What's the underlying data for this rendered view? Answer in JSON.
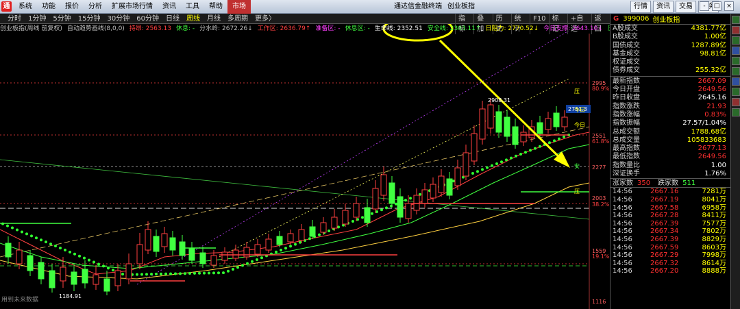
{
  "titlebar": {
    "menu": [
      "系统",
      "功能",
      "报价",
      "分析",
      "扩展市场行情",
      "资讯",
      "工具",
      "帮助",
      "市场"
    ],
    "title": "通达信金融终端",
    "subtitle": "创业板指",
    "buttons": [
      "行情",
      "资讯",
      "交易",
      "服务"
    ],
    "window_controls": [
      "-",
      "□",
      "×"
    ]
  },
  "toolbar": {
    "periods": [
      "分时",
      "1分钟",
      "5分钟",
      "15分钟",
      "30分钟",
      "60分钟",
      "日线",
      "周线",
      "月线",
      "多周期",
      "更多〉"
    ],
    "active_period": "周线",
    "tools": [
      "指标",
      "叠加",
      "历史",
      "统计",
      "F10",
      "标记",
      "+自选",
      "返回"
    ]
  },
  "legend": {
    "items": [
      {
        "text": "创业板指(周线 前复权)",
        "color": "#c0c0c0"
      },
      {
        "text": "自动趋势画线(8,0,0)",
        "color": "#c0c0c0"
      },
      {
        "text": "持昂: 2563.13",
        "color": "#ff4040"
      },
      {
        "text": "休息: -",
        "color": "#40ff40"
      },
      {
        "text": "分水岭: 2672.26↓",
        "color": "#c0c0c0"
      },
      {
        "text": "工作区: 2636.79↑",
        "color": "#ff4040"
      },
      {
        "text": "准备区: -",
        "color": "#ff40ff"
      },
      {
        "text": "休息区: -",
        "color": "#40ff40"
      },
      {
        "text": "生命线: 2352.51",
        "color": "#ffffff"
      },
      {
        "text": "安全线: 2303.11↑",
        "color": "#40ff40"
      },
      {
        "text": "日阻力: 2770.52↓",
        "color": "#ffff00"
      },
      {
        "text": "今日支撑: 2643.10↓",
        "color": "#ff40ff"
      },
      {
        "text": "压力↑",
        "color": "#40ff40"
      }
    ]
  },
  "chart": {
    "price_labels": [
      "2995",
      "80.9%",
      "2551",
      "61.8%",
      "2277",
      "2003",
      "38.2%",
      "1559",
      "19.1%",
      "1116"
    ],
    "price_colors": {
      "level": "#ff6060",
      "percent": "#ff4040",
      "base": "#ff6060"
    },
    "current_price": "2751.3",
    "high_label": "2908.31",
    "low_label": "1184.91",
    "side_markers": [
      "压",
      "今日",
      "今日",
      "安",
      "压"
    ],
    "footer_text": "用到未来数据"
  },
  "panel": {
    "code": "399006",
    "name": "创业板指",
    "stats": [
      {
        "label": "A股成交",
        "value": "4381.77亿",
        "color": "#ffff00"
      },
      {
        "label": "B股成交",
        "value": "1.00亿",
        "color": "#ffff00"
      },
      {
        "label": "国债成交",
        "value": "1287.89亿",
        "color": "#ffff00"
      },
      {
        "label": "基金成交",
        "value": "98.81亿",
        "color": "#ffff00"
      },
      {
        "label": "权证成交",
        "value": "",
        "color": "#ffff00"
      },
      {
        "label": "债券成交",
        "value": "255.32亿",
        "color": "#ffff00"
      },
      {
        "label": "最新指数",
        "value": "2667.09",
        "color": "#ff3030"
      },
      {
        "label": "今日开盘",
        "value": "2649.56",
        "color": "#ff3030"
      },
      {
        "label": "昨日收盘",
        "value": "2645.16",
        "color": "#ffffff"
      },
      {
        "label": "指数涨跌",
        "value": "21.93",
        "color": "#ff3030"
      },
      {
        "label": "指数涨幅",
        "value": "0.83%",
        "color": "#ff3030"
      },
      {
        "label": "指数振幅",
        "value": "27.57/1.04%",
        "color": "#ffffff"
      },
      {
        "label": "总成交额",
        "value": "1788.68亿",
        "color": "#ffff00"
      },
      {
        "label": "总成交量",
        "value": "105833683",
        "color": "#ffff00"
      },
      {
        "label": "最高指数",
        "value": "2677.13",
        "color": "#ff3030"
      },
      {
        "label": "最低指数",
        "value": "2649.56",
        "color": "#ff3030"
      },
      {
        "label": "指数量比",
        "value": "1.00",
        "color": "#ffffff"
      },
      {
        "label": "深证换手",
        "value": "1.76%",
        "color": "#ffffff"
      }
    ],
    "updown": {
      "up_label": "涨家数",
      "up": "350",
      "down_label": "跌家数",
      "down": "511"
    },
    "ticks": [
      {
        "time": "14:56",
        "price": "2667.16",
        "vol": "7281万"
      },
      {
        "time": "14:56",
        "price": "2667.19",
        "vol": "8041万"
      },
      {
        "time": "14:56",
        "price": "2667.58",
        "vol": "6958万"
      },
      {
        "time": "14:56",
        "price": "2667.28",
        "vol": "8411万"
      },
      {
        "time": "14:56",
        "price": "2667.39",
        "vol": "7577万"
      },
      {
        "time": "14:56",
        "price": "2667.34",
        "vol": "7802万"
      },
      {
        "time": "14:56",
        "price": "2667.39",
        "vol": "8829万"
      },
      {
        "time": "14:56",
        "price": "2667.59",
        "vol": "8603万"
      },
      {
        "time": "14:56",
        "price": "2667.29",
        "vol": "7998万"
      },
      {
        "time": "14:56",
        "price": "2667.32",
        "vol": "8614万"
      },
      {
        "time": "14:56",
        "price": "2667.20",
        "vol": "8888万"
      }
    ]
  }
}
